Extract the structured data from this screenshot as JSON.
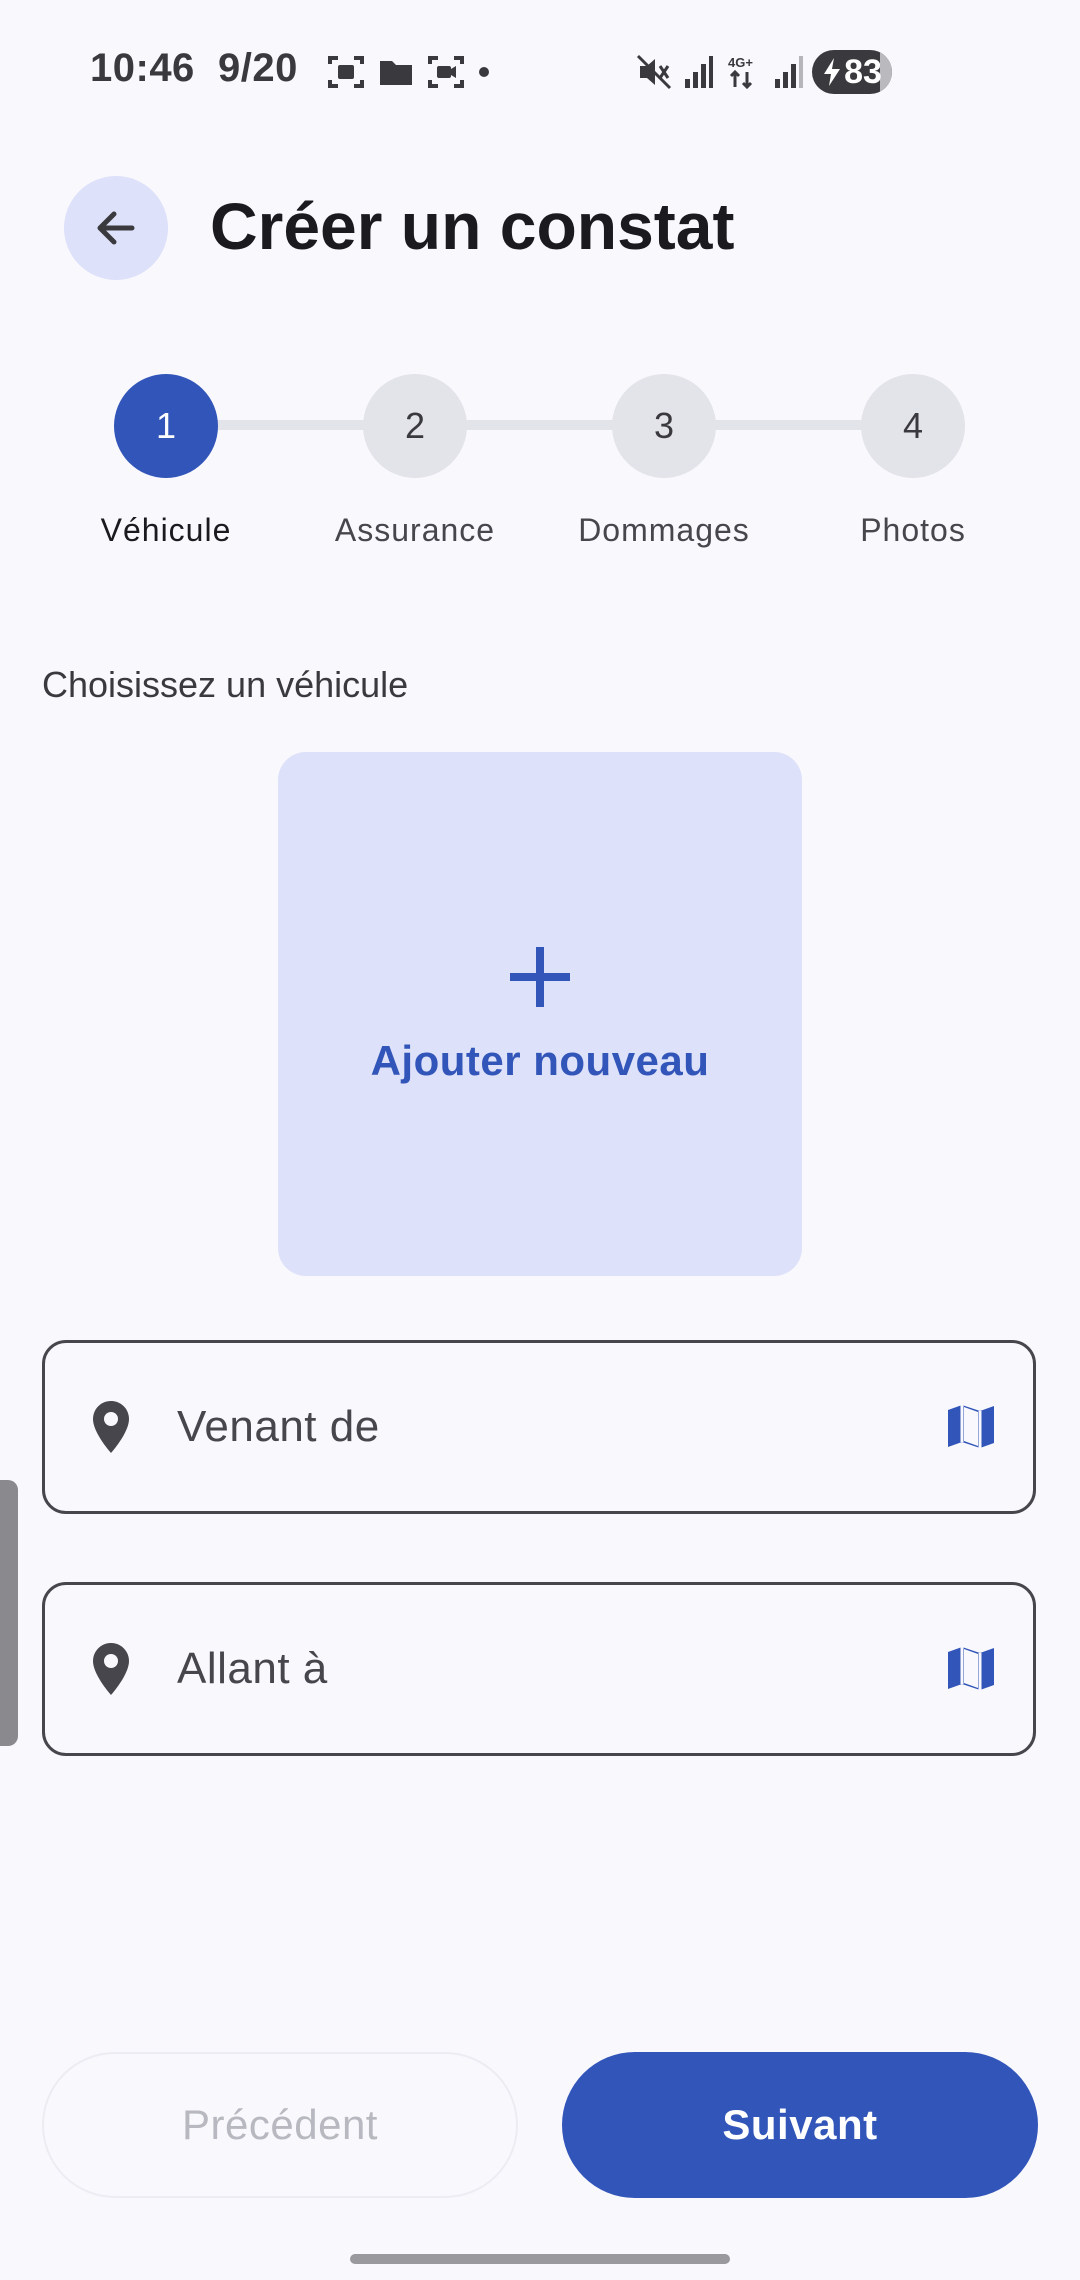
{
  "status_bar": {
    "time": "10:46",
    "date": "9/20",
    "battery": "83",
    "icons": [
      "screenshot-icon",
      "folder-icon",
      "screen-record-icon",
      "dot-icon",
      "mute-icon",
      "signal-icon",
      "4g-signal-icon",
      "signal-icon",
      "battery-charging-icon"
    ]
  },
  "header": {
    "title": "Créer un constat",
    "back_icon": "arrow-back-icon"
  },
  "stepper": {
    "current": 1,
    "steps": [
      {
        "number": "1",
        "label": "Véhicule"
      },
      {
        "number": "2",
        "label": "Assurance"
      },
      {
        "number": "3",
        "label": "Dommages"
      },
      {
        "number": "4",
        "label": "Photos"
      }
    ]
  },
  "vehicle": {
    "section_label": "Choisissez un véhicule",
    "add_label": "Ajouter nouveau",
    "add_icon": "plus-icon"
  },
  "fields": {
    "from_placeholder": "Venant de",
    "to_placeholder": "Allant à",
    "leading_icon": "location-pin-icon",
    "trailing_icon": "map-icon"
  },
  "footer": {
    "prev_label": "Précédent",
    "next_label": "Suivant"
  },
  "colors": {
    "primary": "#3155b8",
    "primary_container": "#dde1f9",
    "background": "#f8f8fd",
    "inactive_step": "#e3e3ea"
  }
}
